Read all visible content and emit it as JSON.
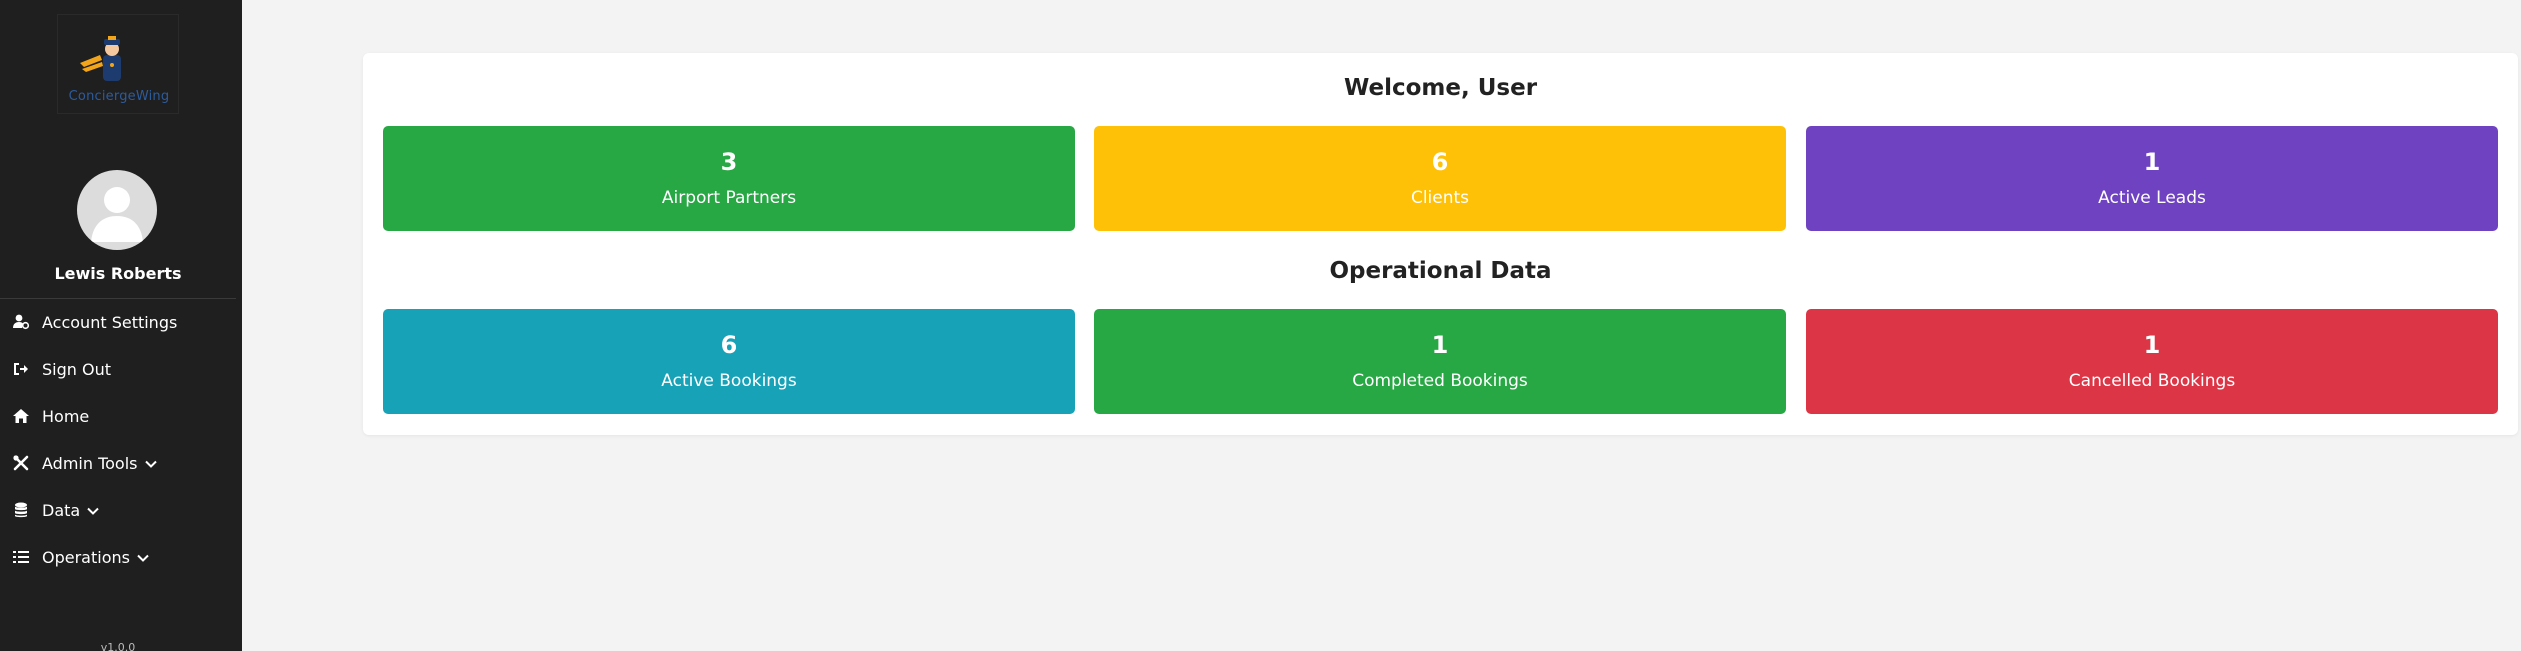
{
  "sidebar": {
    "logo_text": "ConciergeWing",
    "user_name": "Lewis Roberts",
    "items": [
      {
        "label": "Account Settings",
        "icon": "user-gear-icon"
      },
      {
        "label": "Sign Out",
        "icon": "sign-out-icon"
      },
      {
        "label": "Home",
        "icon": "home-icon"
      },
      {
        "label": "Admin Tools",
        "icon": "tools-icon",
        "has_dropdown": true
      },
      {
        "label": "Data",
        "icon": "database-icon",
        "has_dropdown": true
      },
      {
        "label": "Operations",
        "icon": "list-check-icon",
        "has_dropdown": true
      }
    ],
    "version": "v1.0.0"
  },
  "main": {
    "welcome_title": "Welcome, User",
    "summary_tiles": [
      {
        "value": "3",
        "label": "Airport Partners",
        "color": "#28a745"
      },
      {
        "value": "6",
        "label": "Clients",
        "color": "#ffc107"
      },
      {
        "value": "1",
        "label": "Active Leads",
        "color": "#6f42c1"
      }
    ],
    "operational_title": "Operational Data",
    "operational_tiles": [
      {
        "value": "6",
        "label": "Active Bookings",
        "color": "#17a2b8"
      },
      {
        "value": "1",
        "label": "Completed Bookings",
        "color": "#28a745"
      },
      {
        "value": "1",
        "label": "Cancelled Bookings",
        "color": "#dc3545"
      }
    ]
  }
}
